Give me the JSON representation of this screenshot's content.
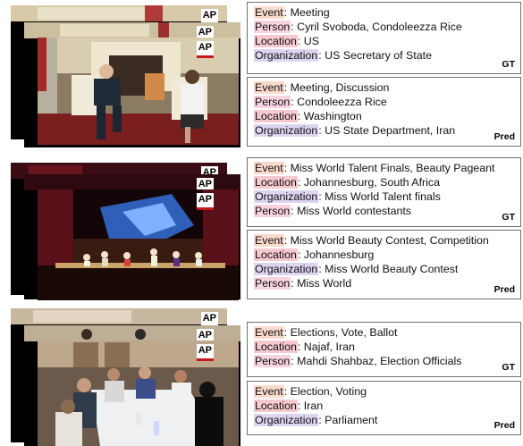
{
  "watermark": "AP",
  "colors": {
    "event": "#fbd9cc",
    "person": "#f7d3e0",
    "location": "#f6c9cf",
    "organization": "#ddd5ef"
  },
  "samples": [
    {
      "gt": {
        "tag": "GT",
        "lines": [
          {
            "key": "Event",
            "value": ": Meeting"
          },
          {
            "key": "Person",
            "value": ": Cyril Svoboda, Condoleezza Rice"
          },
          {
            "key": "Location",
            "value": ": US"
          },
          {
            "key": "Organization",
            "value": ": US Secretary of State"
          }
        ]
      },
      "pred": {
        "tag": "Pred",
        "lines": [
          {
            "key": "Event",
            "value": ": Meeting, Discussion"
          },
          {
            "key": "Person",
            "value": ": Condoleezza Rice"
          },
          {
            "key": "Location",
            "value": ": Washington"
          },
          {
            "key": "Organization",
            "value": ": US State Department, Iran"
          }
        ]
      }
    },
    {
      "gt": {
        "tag": "GT",
        "lines": [
          {
            "key": "Event",
            "value": ": Miss World Talent Finals, Beauty Pageant"
          },
          {
            "key": "Location",
            "value": ": Johannesburg, South Africa"
          },
          {
            "key": "Organization",
            "value": ": Miss World Talent finals"
          },
          {
            "key": "Person",
            "value": ": Miss World contestants"
          }
        ]
      },
      "pred": {
        "tag": "Pred",
        "lines": [
          {
            "key": "Event",
            "value": ": Miss World Beauty Contest, Competition"
          },
          {
            "key": "Location",
            "value": ": Johannesburg"
          },
          {
            "key": "Organization",
            "value": ": Miss World Beauty Contest"
          },
          {
            "key": "Person",
            "value": ": Miss World"
          }
        ]
      }
    },
    {
      "gt": {
        "tag": "GT",
        "lines": [
          {
            "key": "Event",
            "value": ": Elections, Vote, Ballot"
          },
          {
            "key": "Location",
            "value": ": Najaf, Iran"
          },
          {
            "key": "Person",
            "value": ": Mahdi Shahbaz, Election Officials"
          }
        ]
      },
      "pred": {
        "tag": "Pred",
        "lines": [
          {
            "key": "Event",
            "value": ": Election, Voting"
          },
          {
            "key": "Location",
            "value": ": Iran"
          },
          {
            "key": "Organization",
            "value": ": Parliament"
          }
        ]
      }
    }
  ]
}
